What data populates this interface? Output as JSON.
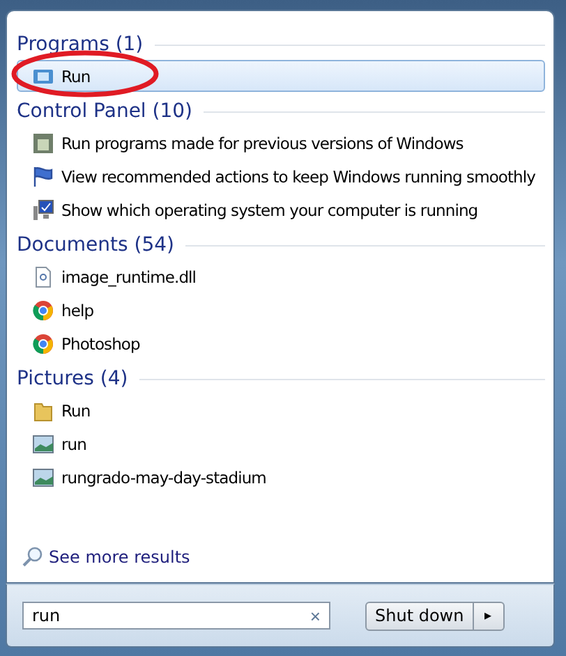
{
  "groups": [
    {
      "heading": "Programs (1)",
      "items": [
        {
          "label": "Run",
          "kind": "run",
          "selected": true
        }
      ]
    },
    {
      "heading": "Control Panel (10)",
      "items": [
        {
          "label": "Run programs made for previous versions of Windows",
          "kind": "compat",
          "selected": false
        },
        {
          "label": "View recommended actions to keep Windows running smoothly",
          "kind": "flag",
          "selected": false
        },
        {
          "label": "Show which operating system your computer is running",
          "kind": "monitor",
          "selected": false
        }
      ]
    },
    {
      "heading": "Documents (54)",
      "items": [
        {
          "label": "image_runtime.dll",
          "kind": "dll",
          "selected": false
        },
        {
          "label": "help",
          "kind": "chrome",
          "selected": false
        },
        {
          "label": "Photoshop",
          "kind": "chrome",
          "selected": false
        }
      ]
    },
    {
      "heading": "Pictures (4)",
      "items": [
        {
          "label": "Run",
          "kind": "folder",
          "selected": false
        },
        {
          "label": "run",
          "kind": "image",
          "selected": false
        },
        {
          "label": "rungrado-may-day-stadium",
          "kind": "image",
          "selected": false
        }
      ]
    }
  ],
  "see_more": "See more results",
  "search": {
    "value": "run",
    "clear": "×"
  },
  "shutdown": {
    "label": "Shut down",
    "arrow": "▸"
  }
}
